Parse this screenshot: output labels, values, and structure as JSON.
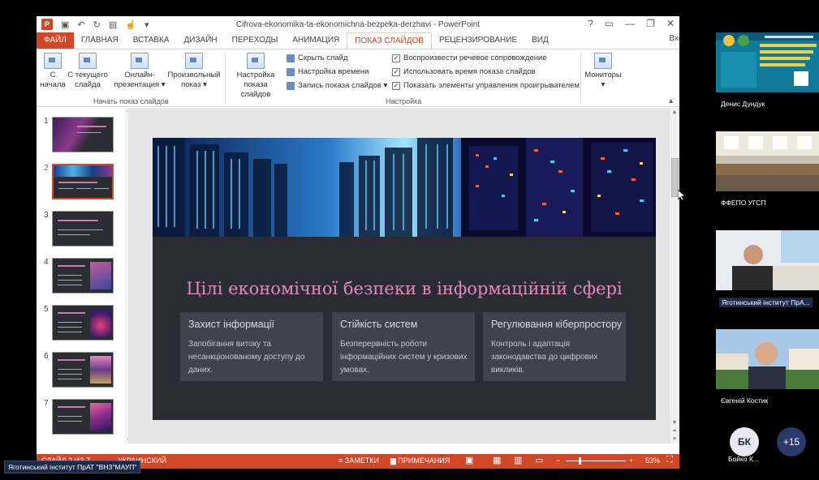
{
  "window": {
    "title": "Cifrova-ekonomika-ta-ekonomichna-bezpeka-derzhavi - PowerPoint",
    "controls": [
      "?",
      "▭",
      "—",
      "❐",
      "✕"
    ],
    "login": "Вход"
  },
  "tabs": [
    "ФАЙЛ",
    "ГЛАВНАЯ",
    "ВСТАВКА",
    "ДИЗАЙН",
    "ПЕРЕХОДЫ",
    "АНИМАЦИЯ",
    "ПОКАЗ СЛАЙДОВ",
    "РЕЦЕНЗИРОВАНИЕ",
    "ВИД"
  ],
  "ribbon": {
    "from_start": [
      "С",
      "начала"
    ],
    "from_current": [
      "С текущего",
      "слайда"
    ],
    "online": [
      "Онлайн-",
      "презентация ▾"
    ],
    "custom": [
      "Произвольный",
      "показ ▾"
    ],
    "group1_label": "Начать показ слайдов",
    "setup": [
      "Настройка",
      "показа слайдов"
    ],
    "hide_slide": "Скрыть слайд",
    "rehearse": "Настройка времени",
    "record": "Запись показа слайдов ▾",
    "play_narrations": "Воспроизвести речевое сопровождение",
    "use_timings": "Использовать время показа слайдов",
    "show_controls": "Показать элементы управления проигрывателем",
    "group2_label": "Настройка",
    "monitors": [
      "Мониторы",
      "▾"
    ]
  },
  "thumbnails": [
    {
      "num": "1",
      "selected": false
    },
    {
      "num": "2",
      "selected": true
    },
    {
      "num": "3",
      "selected": false
    },
    {
      "num": "4",
      "selected": false
    },
    {
      "num": "5",
      "selected": false
    },
    {
      "num": "6",
      "selected": false
    },
    {
      "num": "7",
      "selected": false
    }
  ],
  "slide": {
    "title": "Цілі економічної безпеки в інформаційній сфері",
    "cards": [
      {
        "heading": "Захист інформації",
        "body": "Запобігання витоку та несанкціонованому доступу до даних."
      },
      {
        "heading": "Стійкість систем",
        "body": "Безперервність роботи інформаційних систем у кризових умовах."
      },
      {
        "heading": "Регулювання кіберпростору",
        "body": "Контроль і адаптація законодавства до цифрових викликів."
      }
    ]
  },
  "statusbar": {
    "slide_info": "СЛАЙД 2 ИЗ 7",
    "language": "УКРАИНСКИЙ",
    "notes": "ЗАМЕТКИ",
    "comments": "ПРИМЕЧАНИЯ",
    "zoom": "53%",
    "zoom_level": 0.53
  },
  "presenter_chip": "Яготинський інститут ПрАТ \"ВНЗ\"МАУП\"",
  "participants": [
    {
      "name": "Денис Дундук"
    },
    {
      "name": "ФФЕПО УГСП"
    },
    {
      "name": "Яготинський інститут ПрА..."
    },
    {
      "name": "Євгеній Костик"
    }
  ],
  "extra": {
    "avatar_initials": "БК",
    "avatar_name": "Бойко К...",
    "more_count": "+15"
  },
  "colors": {
    "accent": "#d24726",
    "slide_bg": "#2a2c34",
    "slide_title": "#e08ab8",
    "card_bg": "#40434b"
  }
}
